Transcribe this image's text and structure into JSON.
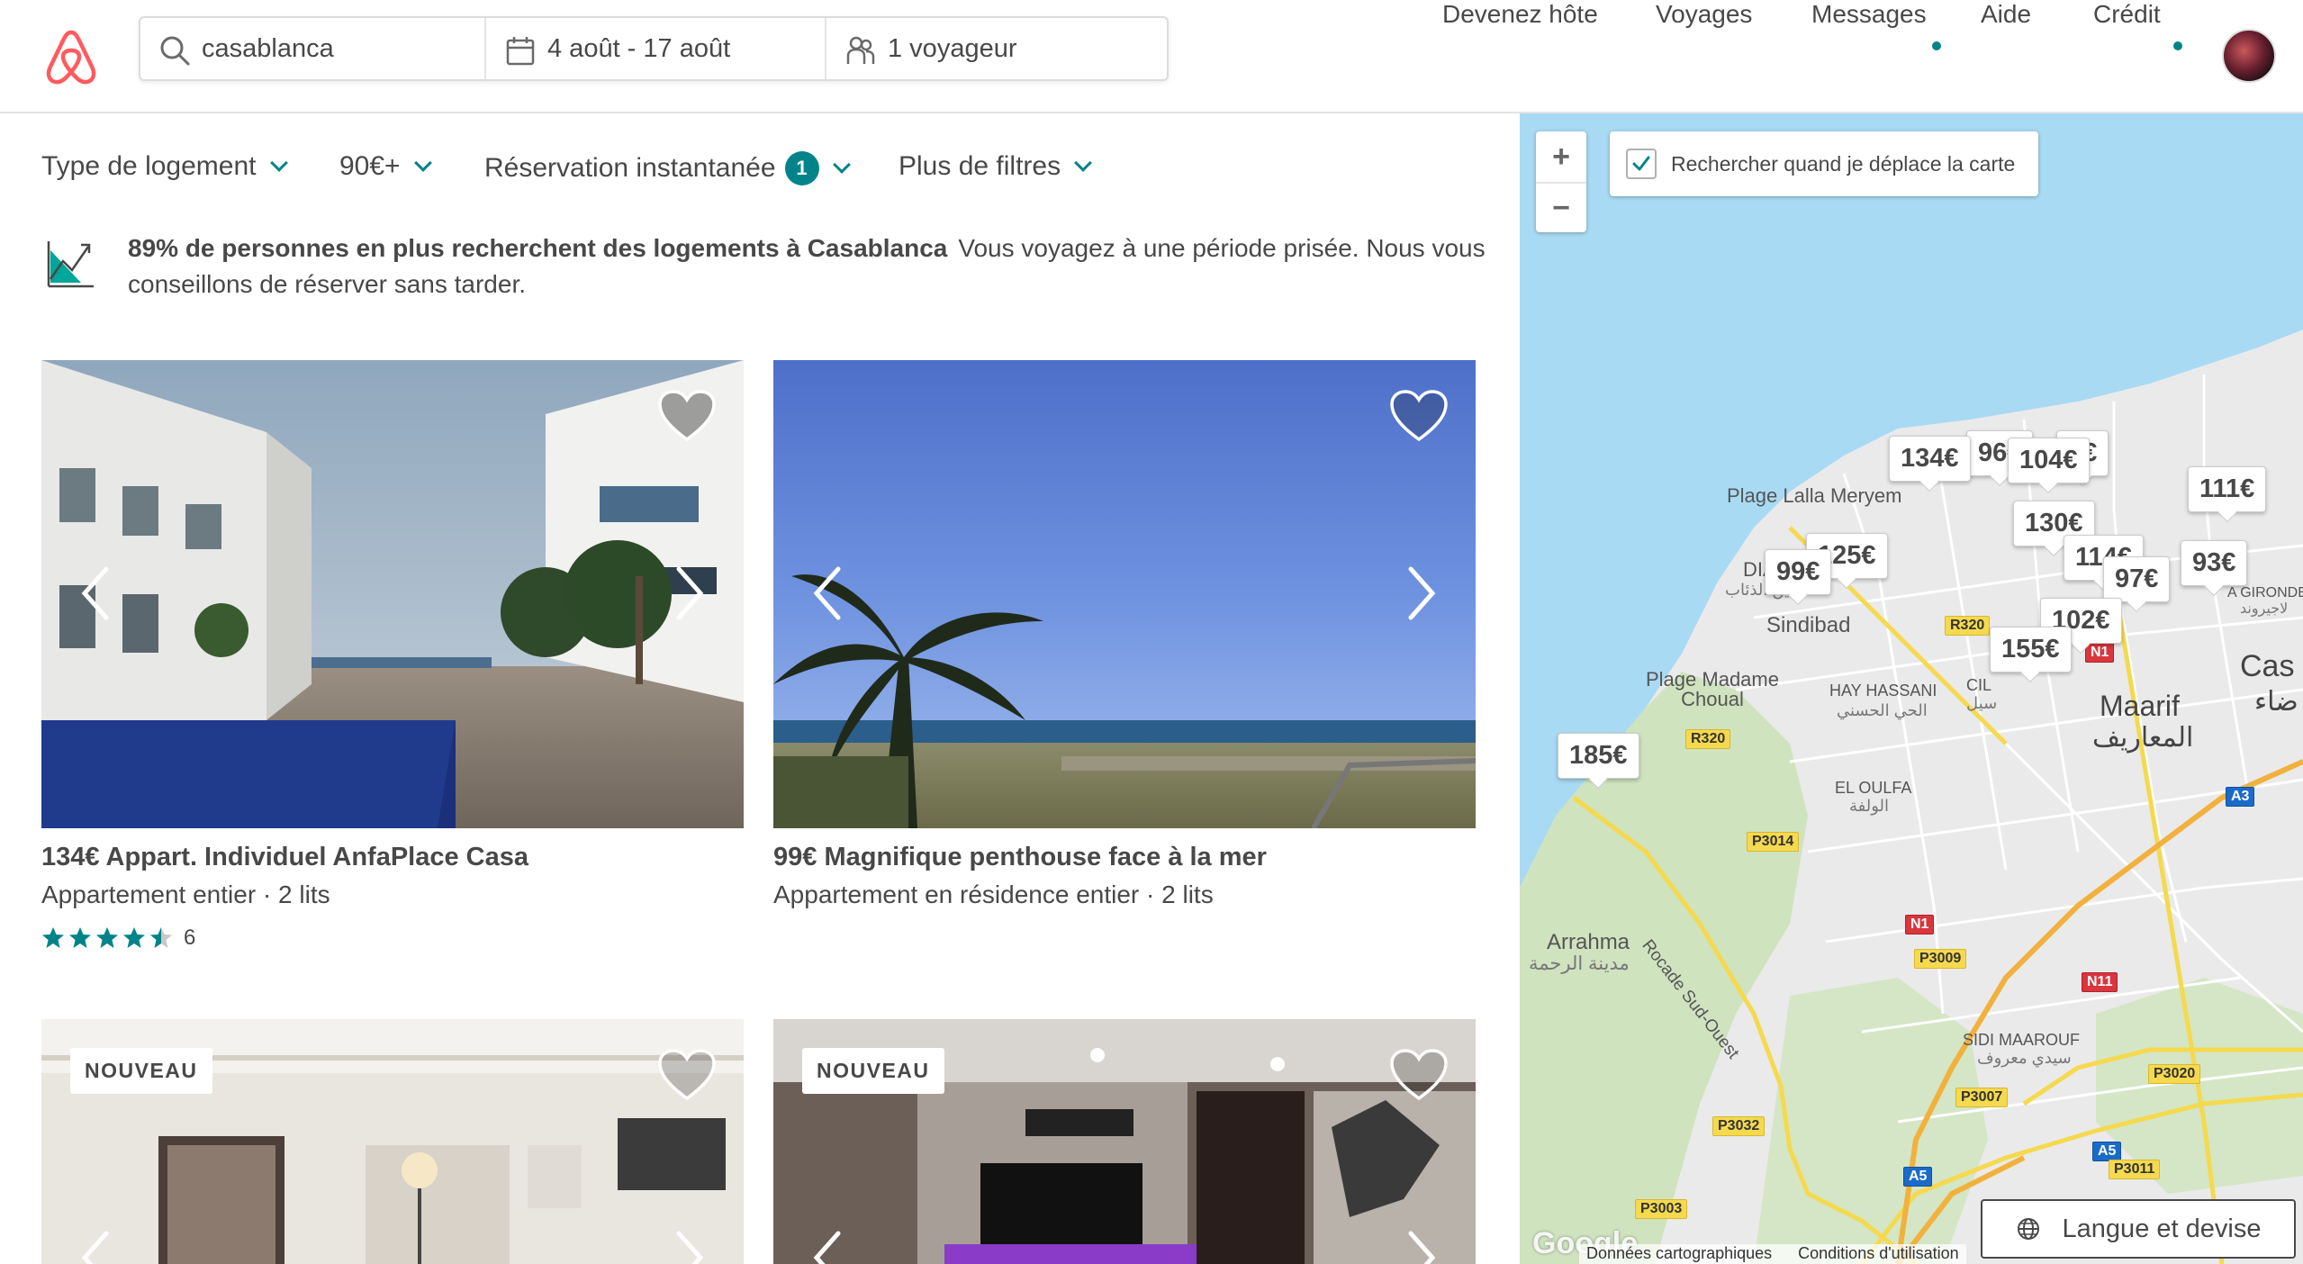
{
  "header": {
    "search": {
      "location": "casablanca",
      "dates": "4 août - 17 août",
      "guests": "1 voyageur"
    },
    "nav": {
      "host": "Devenez hôte",
      "trips": "Voyages",
      "messages": "Messages",
      "help": "Aide",
      "credit": "Crédit"
    }
  },
  "filters": {
    "room_type": "Type de logement",
    "price": "90€+",
    "instant_book": "Réservation instantanée",
    "instant_book_count": "1",
    "more": "Plus de filtres"
  },
  "banner": {
    "bold": "89% de personnes en plus recherchent des logements à Casablanca",
    "text": "Vous voyagez à une période prisée. Nous vous conseillons de réserver sans tarder."
  },
  "listings": [
    {
      "title": "134€ Appart. Individuel AnfaPlace Casa",
      "subtitle": "Appartement entier · 2 lits",
      "rating": 4.5,
      "reviews": "6"
    },
    {
      "title": "99€ Magnifique penthouse face à la mer",
      "subtitle": "Appartement en résidence entier · 2 lits"
    },
    {
      "badge": "NOUVEAU"
    },
    {
      "badge": "NOUVEAU"
    }
  ],
  "map": {
    "search_when_move": "Rechercher quand je déplace la carte",
    "search_when_move_checked": true,
    "pins": [
      "134€",
      "96€",
      "104€",
      "5€",
      "111€",
      "130€",
      "125€",
      "99€",
      "114€",
      "97€",
      "93€",
      "102€",
      "155€",
      "185€"
    ],
    "places": {
      "lalla_meryem": "Plage Lalla Meryem",
      "diab": "DIAB",
      "diab_ar": "عين الذئاب",
      "sindibad": "Sindibad",
      "madame_choual": "Plage Madame Choual",
      "hay_hassani": "HAY HASSANI",
      "hay_hassani_ar": "الحي الحسني",
      "cil": "CIL",
      "cil_ar": "سيل",
      "maarif": "Maarif",
      "maarif_ar": "المعاريف",
      "casa": "Cas",
      "casa_ar": "ضاء",
      "gironde": "A GIRONDE",
      "gironde_ar": "لاجيروند",
      "oulfa": "EL OULFA",
      "oulfa_ar": "الولفة",
      "rocade": "Rocade Sud-Ouest",
      "arrahma": "Arrahma",
      "arrahma_ar": "مدينة الرحمة",
      "sidi_maarouf": "SIDI MAAROUF",
      "sidi_maarouf_ar": "سيدي معروف"
    },
    "roads": [
      "R320",
      "R320",
      "P3014",
      "N1",
      "P3009",
      "N11",
      "A3",
      "P3020",
      "P3007",
      "P3032",
      "A5",
      "P3011",
      "A5",
      "P3003",
      "N1"
    ],
    "attribution": "Données cartographiques",
    "terms": "Conditions d'utilisation",
    "google": "Google",
    "language_button": "Langue et devise"
  },
  "colors": {
    "brand": "#FF5A5F",
    "accent": "#008489",
    "text": "#484848",
    "sea": "#A9DAF3",
    "land": "#EAEAEA"
  }
}
